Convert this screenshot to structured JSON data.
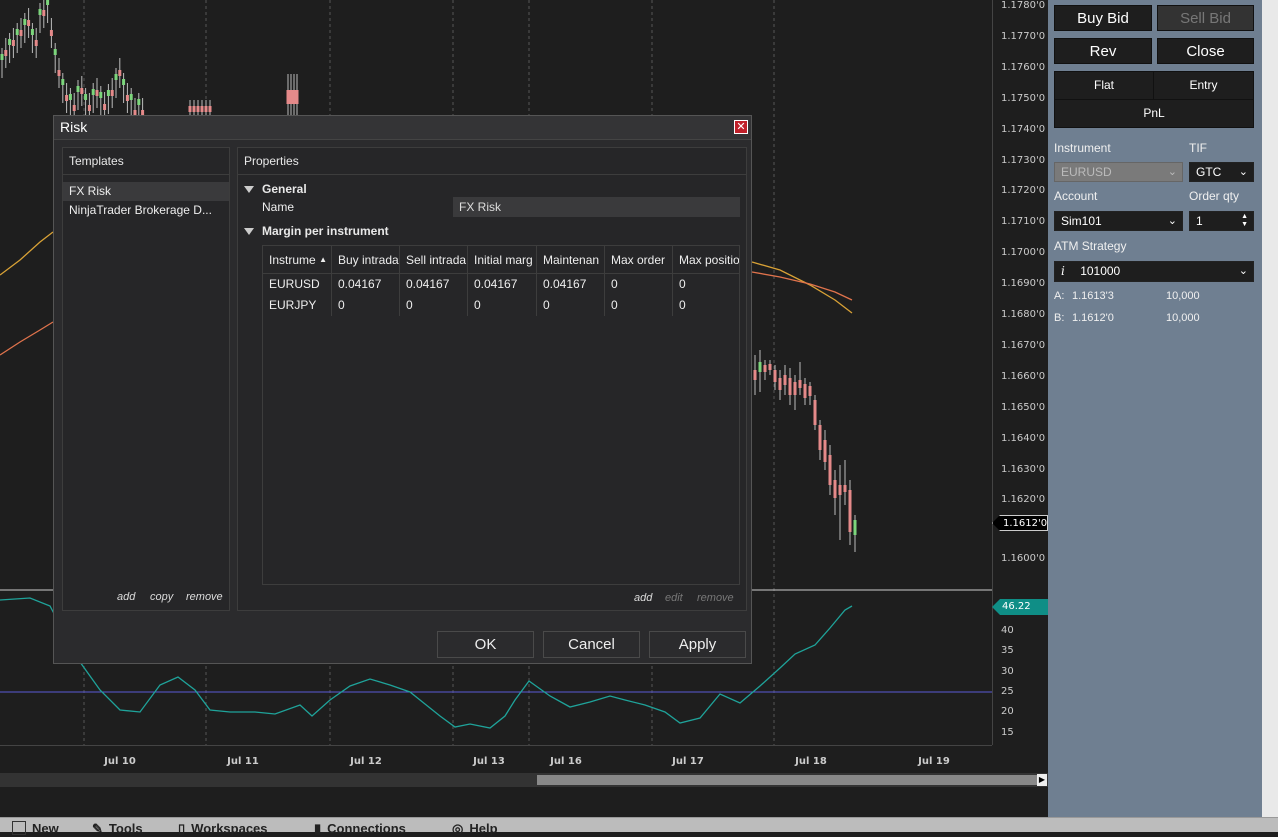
{
  "chart": {
    "price_labels": [
      "1.1780'0",
      "1.1770'0",
      "1.1760'0",
      "1.1750'0",
      "1.1740'0",
      "1.1730'0",
      "1.1720'0",
      "1.1710'0",
      "1.1700'0",
      "1.1690'0",
      "1.1680'0",
      "1.1670'0",
      "1.1660'0",
      "1.1650'0",
      "1.1640'0",
      "1.1630'0",
      "1.1620'0",
      "1.1600'0"
    ],
    "current_price": "1.1612'0",
    "indicator_value": "46.22",
    "indicator_labels": [
      "40",
      "35",
      "30",
      "25",
      "20",
      "15"
    ],
    "time_labels": [
      "Jul 10",
      "Jul 11",
      "Jul 12",
      "Jul 13",
      "Jul 16",
      "Jul 17",
      "Jul 18",
      "Jul 19"
    ],
    "colors": {
      "background": "#1e1e1e",
      "up": "#7cd67c",
      "down": "#e58a8a",
      "ma_fast": "#d9a236",
      "ma_slow": "#e0734c",
      "indicator": "#1fa39a",
      "level": "#5a5ad6"
    }
  },
  "order_panel": {
    "buy_bid": "Buy Bid",
    "sell_bid": "Sell Bid",
    "rev": "Rev",
    "close": "Close",
    "flat": "Flat",
    "entry": "Entry",
    "pnl": "PnL",
    "instrument_label": "Instrument",
    "instrument_value": "EURUSD",
    "tif_label": "TIF",
    "tif_value": "GTC",
    "account_label": "Account",
    "account_value": "Sim101",
    "order_qty_label": "Order qty",
    "order_qty_value": "1",
    "atm_label": "ATM Strategy",
    "atm_value": "101000",
    "ask_label": "A:",
    "ask_price": "1.1613'3",
    "ask_size": "10,000",
    "bid_label": "B:",
    "bid_price": "1.1612'0",
    "bid_size": "10,000"
  },
  "dialog": {
    "title": "Risk",
    "templates_header": "Templates",
    "templates": [
      "FX Risk",
      "NinjaTrader Brokerage D..."
    ],
    "templates_footer": {
      "add": "add",
      "copy": "copy",
      "remove": "remove"
    },
    "properties_header": "Properties",
    "general_section": "General",
    "name_label": "Name",
    "name_value": "FX Risk",
    "margin_section": "Margin per instrument",
    "grid": {
      "columns": [
        "Instrume",
        "Buy intrada",
        "Sell intrada",
        "Initial marg",
        "Maintenan",
        "Max order",
        "Max positio"
      ],
      "rows": [
        [
          "EURUSD",
          "0.04167",
          "0.04167",
          "0.04167",
          "0.04167",
          "0",
          "0"
        ],
        [
          "EURJPY",
          "0",
          "0",
          "0",
          "0",
          "0",
          "0"
        ]
      ]
    },
    "grid_footer": {
      "add": "add",
      "edit": "edit",
      "remove": "remove"
    },
    "ok": "OK",
    "cancel": "Cancel",
    "apply": "Apply"
  },
  "taskbar": {
    "items": [
      "New",
      "Tools",
      "Workspaces",
      "Connections",
      "Help"
    ]
  }
}
